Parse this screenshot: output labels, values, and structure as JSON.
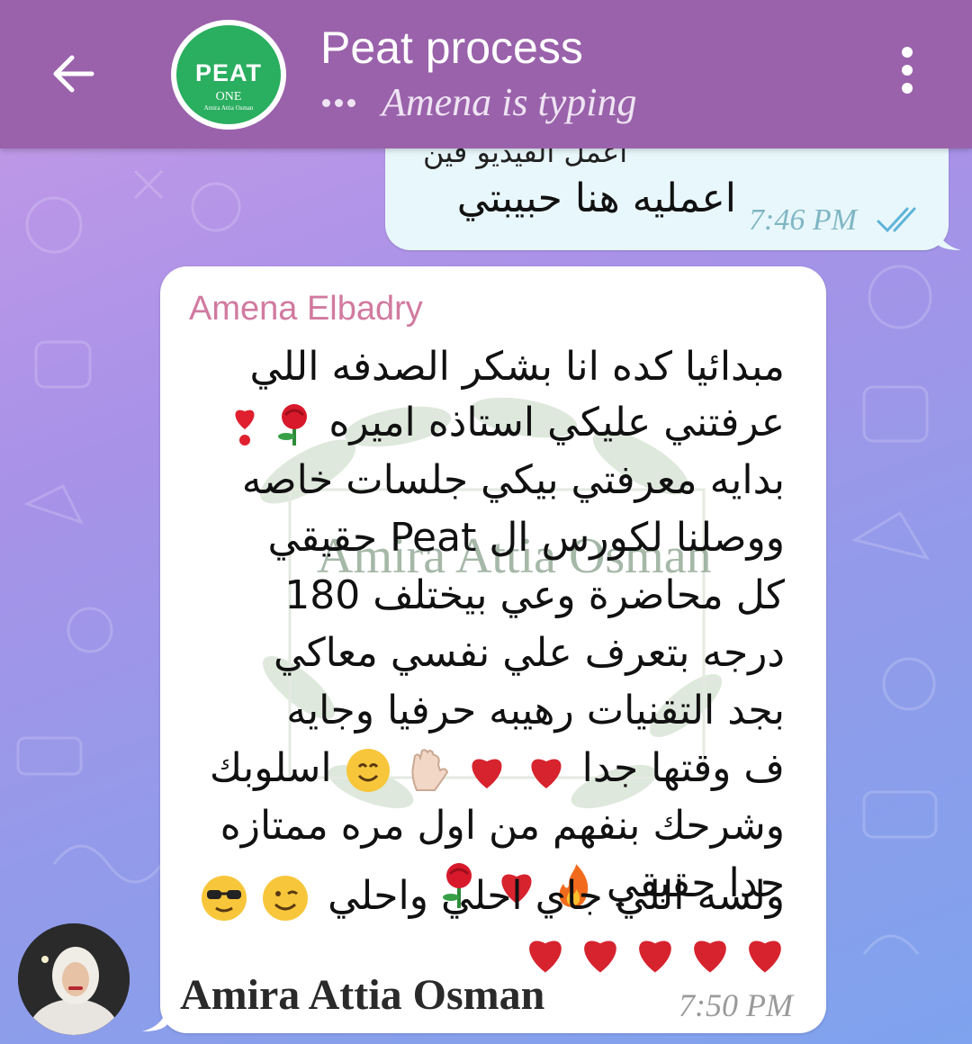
{
  "header": {
    "title": "Peat process",
    "status": "Amena is typing",
    "logo": {
      "main": "PEAT",
      "line2": "ONE",
      "line3": "Amira Attia Osman"
    },
    "icons": {
      "back": "arrow-left-icon",
      "menu": "more-vertical-icon"
    }
  },
  "outgoing": {
    "partial_text": "اعمل الفيديو فين",
    "text": "اعمليه هنا حبيبتي",
    "time": "7:46 PM"
  },
  "incoming": {
    "sender": "Amena Elbadry",
    "lines": [
      "مبدائيا كده انا بشكر الصدفه اللي",
      "عرفتني عليكي استاذه اميره",
      "بدايه معرفتي بيكي جلسات خاصه",
      "ووصلنا لكورس ال Peat حقيقي",
      "كل محاضرة وعي بيختلف 180",
      "درجه بتعرف علي نفسي معاكي",
      "بجد التقنيات رهيبه حرفيا وجايه",
      "ف وقتها جدا",
      "اسلوبك",
      "وشرحك بنفهم من اول مره ممتازه",
      "جدا حقيقي",
      "ولسه اللي جاي احلي واحلي"
    ],
    "signature": "Amira Attia Osman",
    "time": "7:50 PM",
    "watermark": {
      "line1": "Amira Attia Osman"
    }
  },
  "colors": {
    "header": "#9a62ab",
    "sender": "#d17aa0",
    "outgoing_bubble": "#e8f7fb",
    "incoming_bubble": "#ffffff",
    "check": "#5fb3d9"
  }
}
